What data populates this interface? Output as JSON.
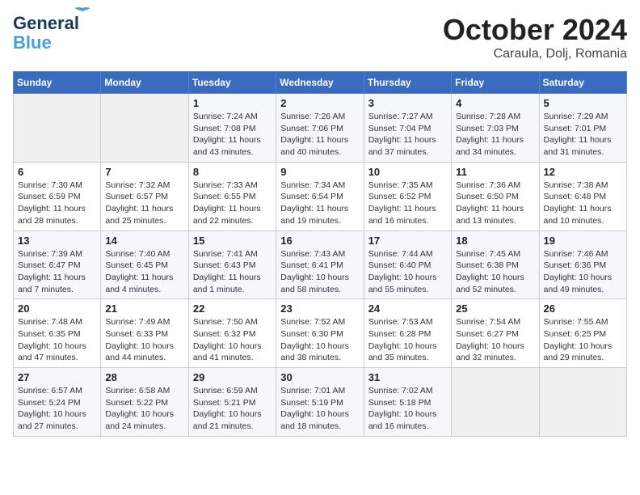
{
  "header": {
    "logo_line1": "General",
    "logo_line2": "Blue",
    "month": "October 2024",
    "location": "Caraula, Dolj, Romania"
  },
  "weekdays": [
    "Sunday",
    "Monday",
    "Tuesday",
    "Wednesday",
    "Thursday",
    "Friday",
    "Saturday"
  ],
  "weeks": [
    [
      {
        "day": "",
        "sunrise": "",
        "sunset": "",
        "daylight": ""
      },
      {
        "day": "",
        "sunrise": "",
        "sunset": "",
        "daylight": ""
      },
      {
        "day": "1",
        "sunrise": "Sunrise: 7:24 AM",
        "sunset": "Sunset: 7:08 PM",
        "daylight": "Daylight: 11 hours and 43 minutes."
      },
      {
        "day": "2",
        "sunrise": "Sunrise: 7:26 AM",
        "sunset": "Sunset: 7:06 PM",
        "daylight": "Daylight: 11 hours and 40 minutes."
      },
      {
        "day": "3",
        "sunrise": "Sunrise: 7:27 AM",
        "sunset": "Sunset: 7:04 PM",
        "daylight": "Daylight: 11 hours and 37 minutes."
      },
      {
        "day": "4",
        "sunrise": "Sunrise: 7:28 AM",
        "sunset": "Sunset: 7:03 PM",
        "daylight": "Daylight: 11 hours and 34 minutes."
      },
      {
        "day": "5",
        "sunrise": "Sunrise: 7:29 AM",
        "sunset": "Sunset: 7:01 PM",
        "daylight": "Daylight: 11 hours and 31 minutes."
      }
    ],
    [
      {
        "day": "6",
        "sunrise": "Sunrise: 7:30 AM",
        "sunset": "Sunset: 6:59 PM",
        "daylight": "Daylight: 11 hours and 28 minutes."
      },
      {
        "day": "7",
        "sunrise": "Sunrise: 7:32 AM",
        "sunset": "Sunset: 6:57 PM",
        "daylight": "Daylight: 11 hours and 25 minutes."
      },
      {
        "day": "8",
        "sunrise": "Sunrise: 7:33 AM",
        "sunset": "Sunset: 6:55 PM",
        "daylight": "Daylight: 11 hours and 22 minutes."
      },
      {
        "day": "9",
        "sunrise": "Sunrise: 7:34 AM",
        "sunset": "Sunset: 6:54 PM",
        "daylight": "Daylight: 11 hours and 19 minutes."
      },
      {
        "day": "10",
        "sunrise": "Sunrise: 7:35 AM",
        "sunset": "Sunset: 6:52 PM",
        "daylight": "Daylight: 11 hours and 16 minutes."
      },
      {
        "day": "11",
        "sunrise": "Sunrise: 7:36 AM",
        "sunset": "Sunset: 6:50 PM",
        "daylight": "Daylight: 11 hours and 13 minutes."
      },
      {
        "day": "12",
        "sunrise": "Sunrise: 7:38 AM",
        "sunset": "Sunset: 6:48 PM",
        "daylight": "Daylight: 11 hours and 10 minutes."
      }
    ],
    [
      {
        "day": "13",
        "sunrise": "Sunrise: 7:39 AM",
        "sunset": "Sunset: 6:47 PM",
        "daylight": "Daylight: 11 hours and 7 minutes."
      },
      {
        "day": "14",
        "sunrise": "Sunrise: 7:40 AM",
        "sunset": "Sunset: 6:45 PM",
        "daylight": "Daylight: 11 hours and 4 minutes."
      },
      {
        "day": "15",
        "sunrise": "Sunrise: 7:41 AM",
        "sunset": "Sunset: 6:43 PM",
        "daylight": "Daylight: 11 hours and 1 minute."
      },
      {
        "day": "16",
        "sunrise": "Sunrise: 7:43 AM",
        "sunset": "Sunset: 6:41 PM",
        "daylight": "Daylight: 10 hours and 58 minutes."
      },
      {
        "day": "17",
        "sunrise": "Sunrise: 7:44 AM",
        "sunset": "Sunset: 6:40 PM",
        "daylight": "Daylight: 10 hours and 55 minutes."
      },
      {
        "day": "18",
        "sunrise": "Sunrise: 7:45 AM",
        "sunset": "Sunset: 6:38 PM",
        "daylight": "Daylight: 10 hours and 52 minutes."
      },
      {
        "day": "19",
        "sunrise": "Sunrise: 7:46 AM",
        "sunset": "Sunset: 6:36 PM",
        "daylight": "Daylight: 10 hours and 49 minutes."
      }
    ],
    [
      {
        "day": "20",
        "sunrise": "Sunrise: 7:48 AM",
        "sunset": "Sunset: 6:35 PM",
        "daylight": "Daylight: 10 hours and 47 minutes."
      },
      {
        "day": "21",
        "sunrise": "Sunrise: 7:49 AM",
        "sunset": "Sunset: 6:33 PM",
        "daylight": "Daylight: 10 hours and 44 minutes."
      },
      {
        "day": "22",
        "sunrise": "Sunrise: 7:50 AM",
        "sunset": "Sunset: 6:32 PM",
        "daylight": "Daylight: 10 hours and 41 minutes."
      },
      {
        "day": "23",
        "sunrise": "Sunrise: 7:52 AM",
        "sunset": "Sunset: 6:30 PM",
        "daylight": "Daylight: 10 hours and 38 minutes."
      },
      {
        "day": "24",
        "sunrise": "Sunrise: 7:53 AM",
        "sunset": "Sunset: 6:28 PM",
        "daylight": "Daylight: 10 hours and 35 minutes."
      },
      {
        "day": "25",
        "sunrise": "Sunrise: 7:54 AM",
        "sunset": "Sunset: 6:27 PM",
        "daylight": "Daylight: 10 hours and 32 minutes."
      },
      {
        "day": "26",
        "sunrise": "Sunrise: 7:55 AM",
        "sunset": "Sunset: 6:25 PM",
        "daylight": "Daylight: 10 hours and 29 minutes."
      }
    ],
    [
      {
        "day": "27",
        "sunrise": "Sunrise: 6:57 AM",
        "sunset": "Sunset: 5:24 PM",
        "daylight": "Daylight: 10 hours and 27 minutes."
      },
      {
        "day": "28",
        "sunrise": "Sunrise: 6:58 AM",
        "sunset": "Sunset: 5:22 PM",
        "daylight": "Daylight: 10 hours and 24 minutes."
      },
      {
        "day": "29",
        "sunrise": "Sunrise: 6:59 AM",
        "sunset": "Sunset: 5:21 PM",
        "daylight": "Daylight: 10 hours and 21 minutes."
      },
      {
        "day": "30",
        "sunrise": "Sunrise: 7:01 AM",
        "sunset": "Sunset: 5:19 PM",
        "daylight": "Daylight: 10 hours and 18 minutes."
      },
      {
        "day": "31",
        "sunrise": "Sunrise: 7:02 AM",
        "sunset": "Sunset: 5:18 PM",
        "daylight": "Daylight: 10 hours and 16 minutes."
      },
      {
        "day": "",
        "sunrise": "",
        "sunset": "",
        "daylight": ""
      },
      {
        "day": "",
        "sunrise": "",
        "sunset": "",
        "daylight": ""
      }
    ]
  ]
}
